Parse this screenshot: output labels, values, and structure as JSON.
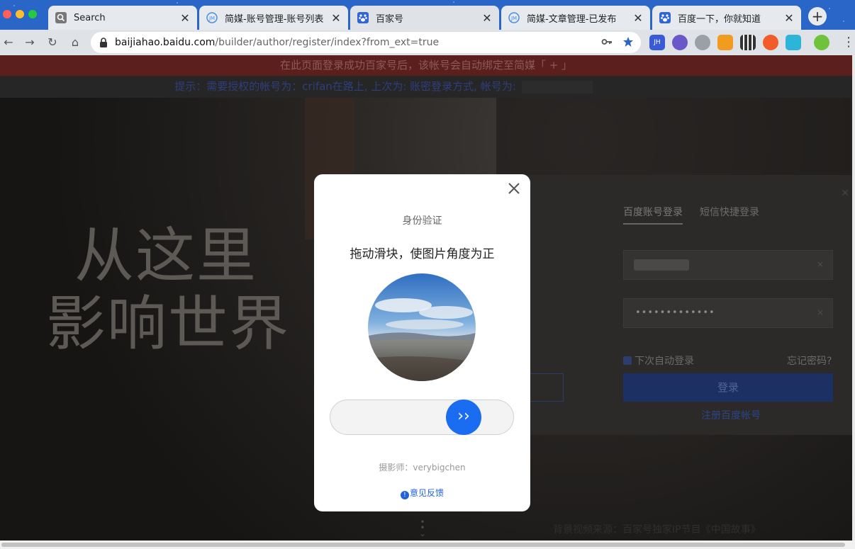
{
  "browser": {
    "tabs": [
      {
        "title": "Search",
        "icon": "search-icon",
        "active": false
      },
      {
        "title": "简媒-账号管理-账号列表",
        "icon": "jianmei-icon",
        "active": false
      },
      {
        "title": "百家号",
        "icon": "baidu-paw-icon",
        "active": true
      },
      {
        "title": "简媒-文章管理-已发布",
        "icon": "jianmei-icon",
        "active": false
      },
      {
        "title": "百度一下，你就知道",
        "icon": "baidu-paw-icon",
        "active": false
      }
    ],
    "new_tab_label": "+",
    "url_host": "baijiahao.baidu.com",
    "url_path": "/builder/author/register/index?from_ext=true",
    "extensions": [
      {
        "icon": "jh-extension-icon",
        "color": "#3a5bd8"
      },
      {
        "icon": "wb-extension-icon",
        "color": "#6a57c9"
      },
      {
        "icon": "gear-extension-icon",
        "color": "#9aa0a6"
      },
      {
        "icon": "shopping-extension-icon",
        "color": "#f29c1f"
      },
      {
        "icon": "qr-code-extension-icon",
        "color": "#333333"
      },
      {
        "icon": "orange-extension-icon",
        "color": "#f25c2a"
      },
      {
        "icon": "chart-extension-icon",
        "color": "#2cb5d9"
      },
      {
        "icon": "profile-avatar-icon",
        "color": "#6fc23b"
      }
    ]
  },
  "page": {
    "notice_red": "在此页面登录成功百家号后，该帐号会自动绑定至简媒「 + 」",
    "notice_blue": "提示：需要授权的帐号为：crifan在路上, 上次为: 账密登录方式, 帐号为:",
    "slogan_line1": "从这里",
    "slogan_line2": "影响世界",
    "login": {
      "tab_account": "百度账号登录",
      "tab_sms": "短信快捷登录",
      "password_mask": "•••••••••••••",
      "clear_symbol": "×",
      "remember_label": "下次自动登录",
      "forgot_label": "忘记密码?",
      "login_button": "登录",
      "register_link": "注册百度帐号"
    },
    "bg_credit": "背景视频来源：百家号独家IP节目《中国故事》"
  },
  "captcha": {
    "title": "身份验证",
    "instruction": "拖动滑块，使图片角度为正",
    "handle_label": "››",
    "photo_credit": "摄影师：verybigchen",
    "feedback_label": "意见反馈",
    "slider_position_fraction": 0
  }
}
